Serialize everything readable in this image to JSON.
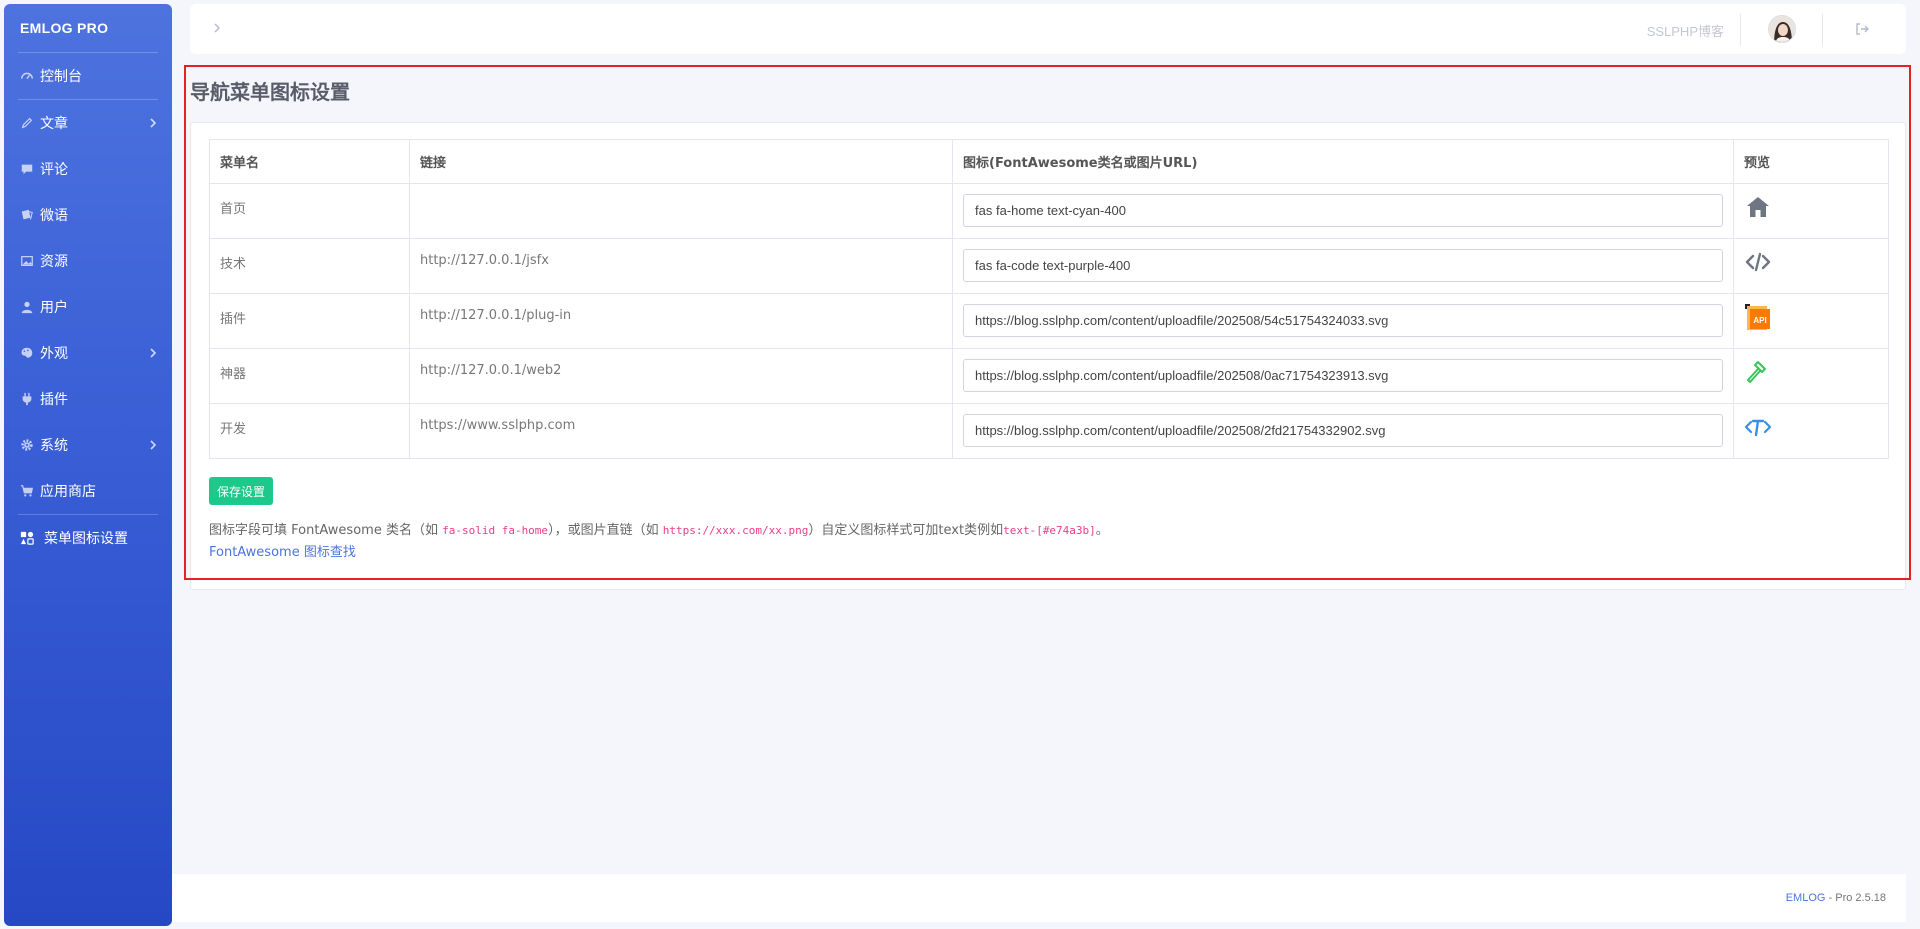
{
  "sidebar": {
    "brand": "EMLOG PRO",
    "items": [
      {
        "label": "控制台",
        "icon": "dashboard-icon",
        "has_sub": false
      },
      {
        "label": "文章",
        "icon": "pencil-icon",
        "has_sub": true
      },
      {
        "label": "评论",
        "icon": "comment-icon",
        "has_sub": false
      },
      {
        "label": "微语",
        "icon": "note-icon",
        "has_sub": false
      },
      {
        "label": "资源",
        "icon": "image-icon",
        "has_sub": false
      },
      {
        "label": "用户",
        "icon": "user-icon",
        "has_sub": false
      },
      {
        "label": "外观",
        "icon": "palette-icon",
        "has_sub": true
      },
      {
        "label": "插件",
        "icon": "plug-icon",
        "has_sub": false
      },
      {
        "label": "系统",
        "icon": "gear-icon",
        "has_sub": true
      },
      {
        "label": "应用商店",
        "icon": "cart-icon",
        "has_sub": false
      },
      {
        "label": "菜单图标设置",
        "icon": "icons-icon",
        "has_sub": false
      }
    ]
  },
  "topbar": {
    "site_name": "SSLPHP博客"
  },
  "main": {
    "title": "导航菜单图标设置",
    "table": {
      "headers": [
        "菜单名",
        "链接",
        "图标(FontAwesome类名或图片URL)",
        "预览"
      ],
      "rows": [
        {
          "name": "首页",
          "link": "",
          "icon": "fas fa-home text-cyan-400",
          "preview": "home-icon",
          "preview_color": "#6e7583"
        },
        {
          "name": "技术",
          "link": "http://127.0.0.1/jsfx",
          "icon": "fas fa-code text-purple-400",
          "preview": "code-icon",
          "preview_color": "#6e7583"
        },
        {
          "name": "插件",
          "link": "http://127.0.0.1/plug-in",
          "icon": "https://blog.sslphp.com/content/uploadfile/202508/54c51754324033.svg",
          "preview": "api-file-icon",
          "preview_color": "#f57c00"
        },
        {
          "name": "神器",
          "link": "http://127.0.0.1/web2",
          "icon": "https://blog.sslphp.com/content/uploadfile/202508/0ac71754323913.svg",
          "preview": "hammer-icon",
          "preview_color": "#34c759"
        },
        {
          "name": "开发",
          "link": "https://www.sslphp.com",
          "icon": "https://blog.sslphp.com/content/uploadfile/202508/2fd21754332902.svg",
          "preview": "dev-code-icon",
          "preview_color": "#3b8ee8"
        }
      ]
    },
    "save_label": "保存设置",
    "help": {
      "t1": "图标字段可填 FontAwesome 类名（如 ",
      "c1": "fa-solid fa-home",
      "t2": "），或图片直链（如 ",
      "c2": "https://xxx.com/xx.png",
      "t3": "）自定义图标样式可加text类例如",
      "c3": "text-[#e74a3b]",
      "t4": "。"
    },
    "help_link": "FontAwesome 图标查找"
  },
  "footer": {
    "brand": "EMLOG",
    "version": " - Pro 2.5.18"
  },
  "colors": {
    "sidebar_top": "#4e73df",
    "sidebar_bottom": "#2648c5",
    "save_button": "#1cc88a",
    "highlight_border": "#e02424",
    "link": "#4e73df"
  }
}
